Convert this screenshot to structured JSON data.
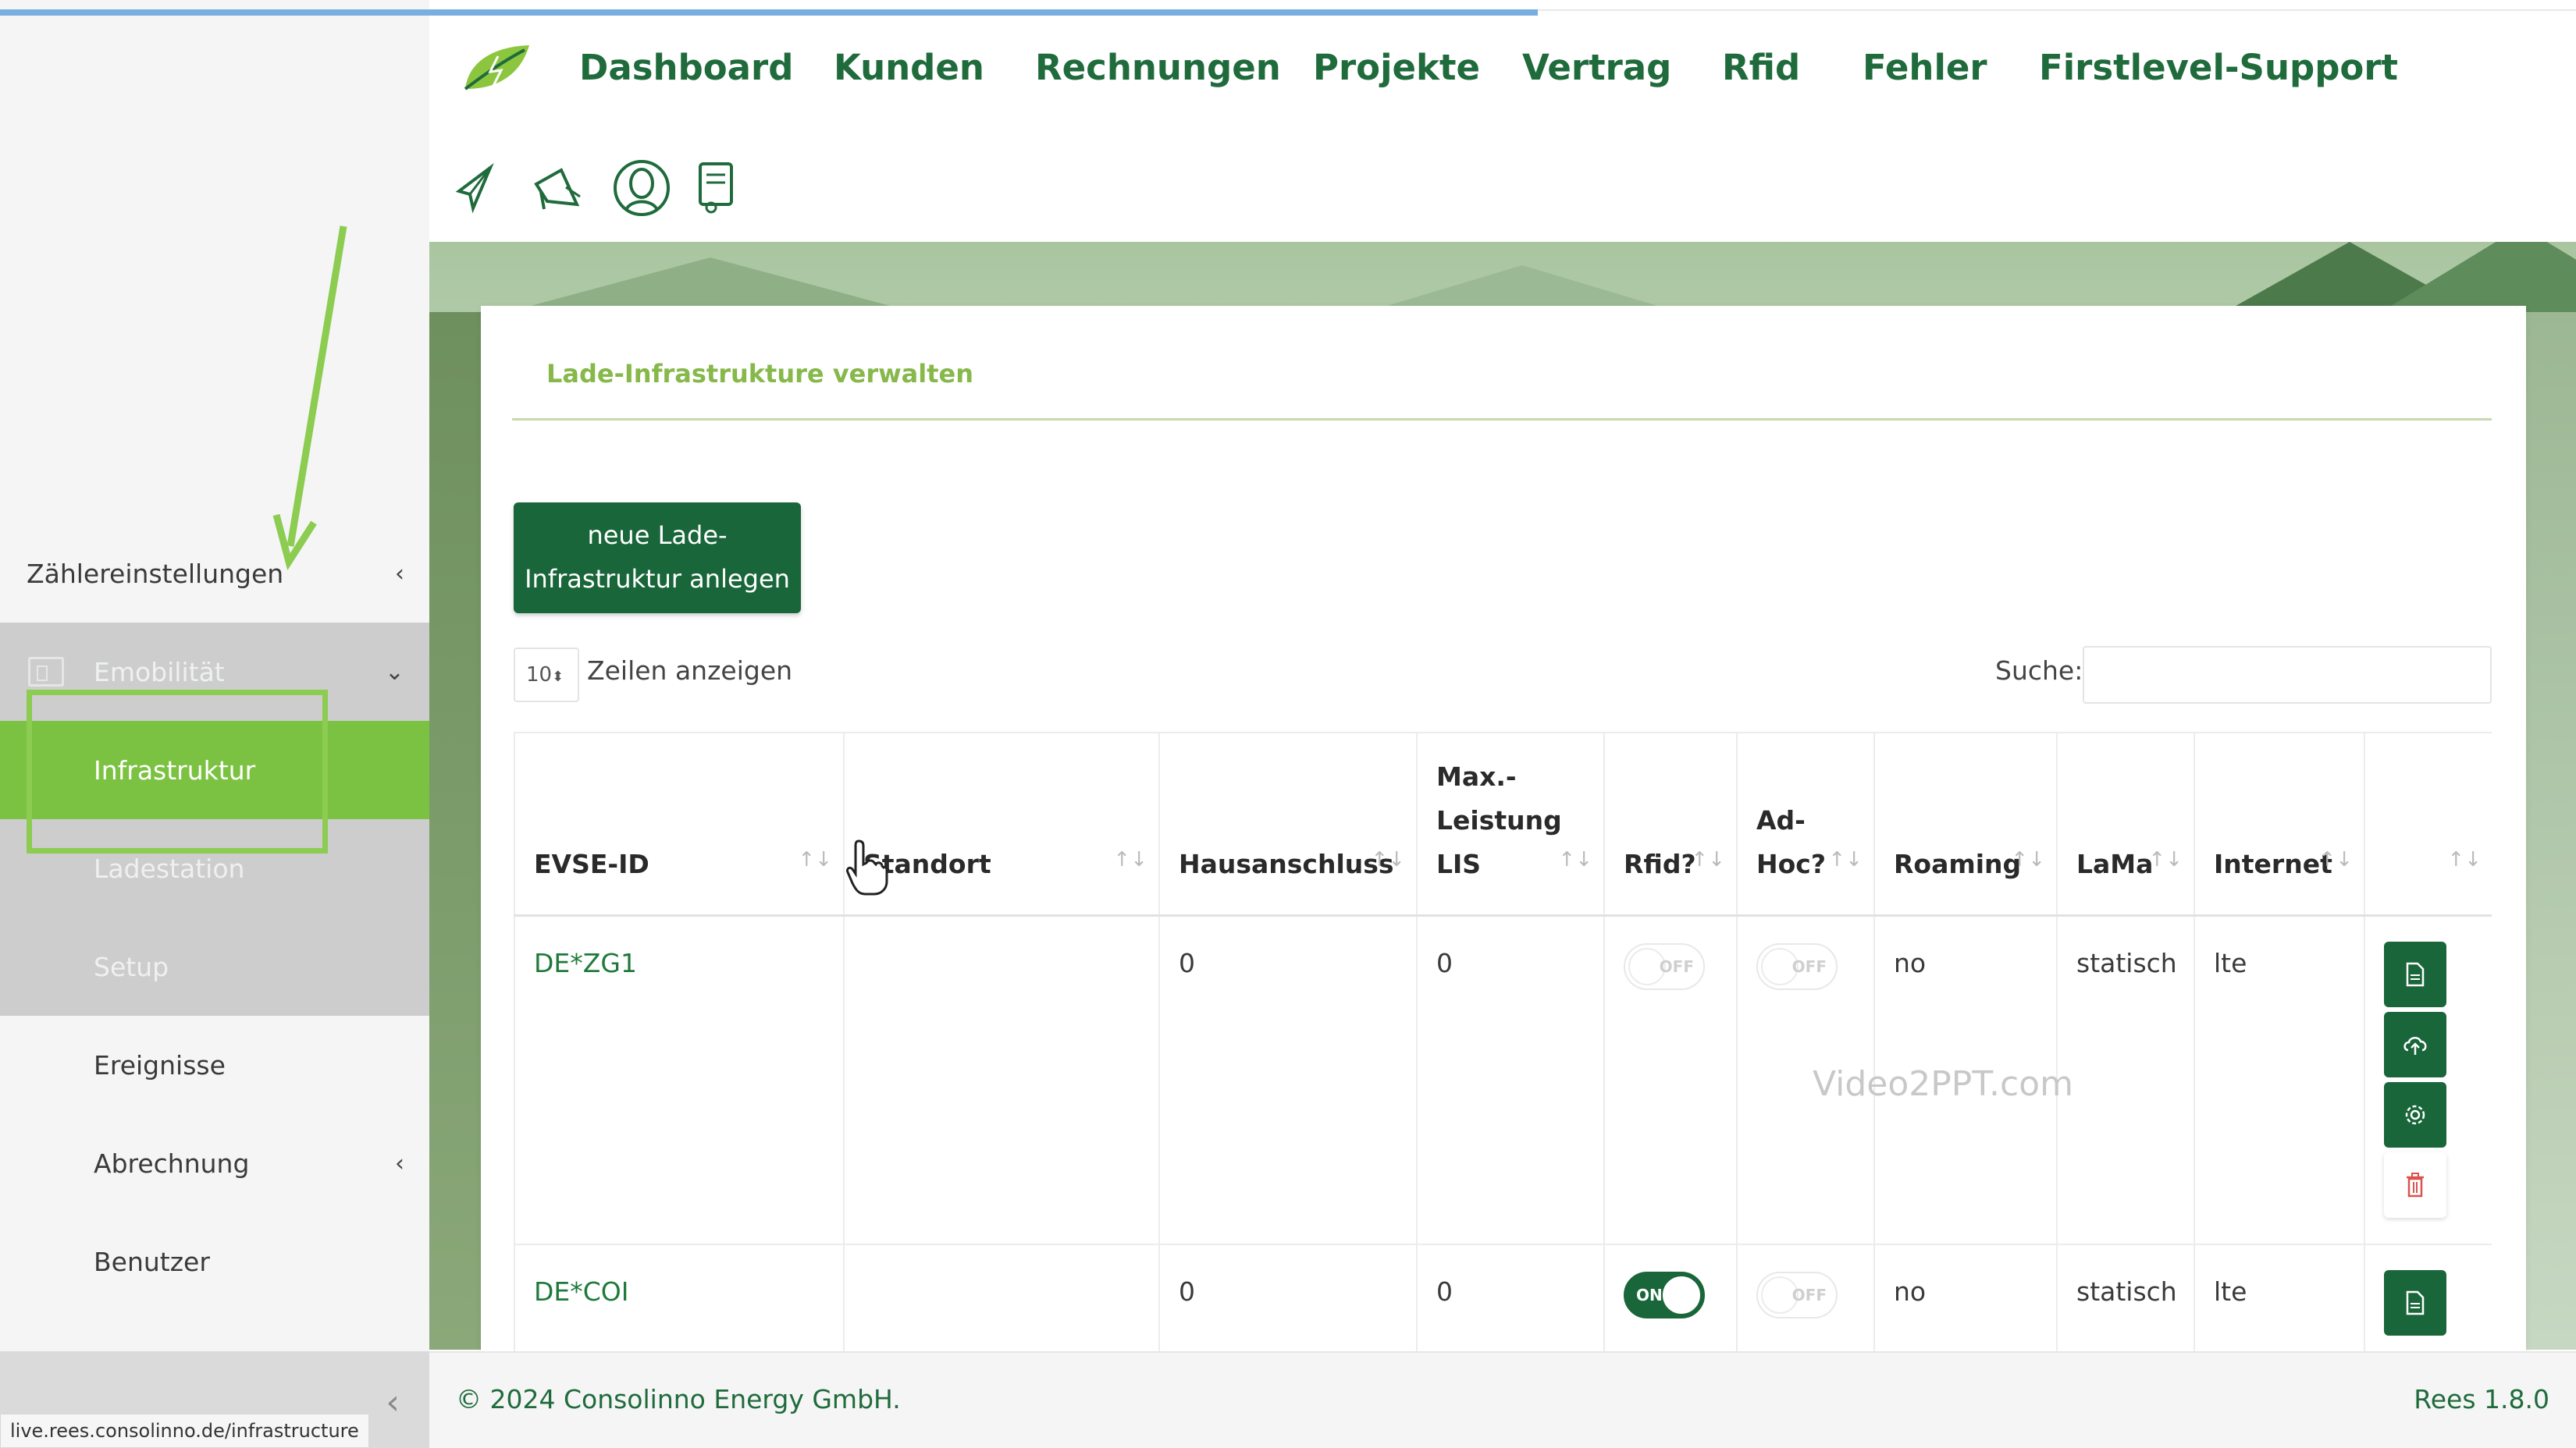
{
  "nav": {
    "items": [
      "Dashboard",
      "Kunden",
      "Rechnungen",
      "Projekte",
      "Vertrag",
      "Rfid",
      "Fehler",
      "Firstlevel-Support"
    ]
  },
  "toolbar_icons": [
    "send-icon",
    "megaphone-icon",
    "support-agent-icon",
    "invoice-icon"
  ],
  "sidebar": {
    "zaehler": "Zählereinstellungen",
    "emob": "Emobilität",
    "infra": "Infrastruktur",
    "ladestation": "Ladestation",
    "setup": "Setup",
    "ereignisse": "Ereignisse",
    "abrechnung": "Abrechnung",
    "benutzer": "Benutzer"
  },
  "card": {
    "title": "Lade-Infrastrukture verwalten",
    "new_button": "neue Lade-Infrastruktur anlegen",
    "page_length": "10",
    "page_length_label": "Zeilen anzeigen",
    "search_label": "Suche:"
  },
  "table": {
    "headers": [
      "EVSE-ID",
      "Standort",
      "Hausanschluss",
      "Max.-Leistung LIS",
      "Rfid?",
      "Ad-Hoc?",
      "Roaming",
      "LaMa",
      "Internet",
      ""
    ],
    "rows": [
      {
        "evse": "DE*ZG1",
        "standort": "",
        "hausanschluss": "0",
        "leistung": "0",
        "rfid": "OFF",
        "adhoc": "OFF",
        "roaming": "no",
        "lama": "statisch",
        "internet": "lte"
      },
      {
        "evse": "DE*COI",
        "standort": "",
        "hausanschluss": "0",
        "leistung": "0",
        "rfid": "ON",
        "adhoc": "OFF",
        "roaming": "no",
        "lama": "statisch",
        "internet": "lte"
      }
    ]
  },
  "footer": {
    "copyright": "© 2024 Consolinno Energy GmbH.",
    "version": "Rees 1.8.0"
  },
  "status_url": "live.rees.consolinno.de/infrastructure",
  "watermark": "Video2PPT.com",
  "colors": {
    "brand_green": "#19663a",
    "accent_green": "#7cc242",
    "title_green": "#86b84a"
  }
}
